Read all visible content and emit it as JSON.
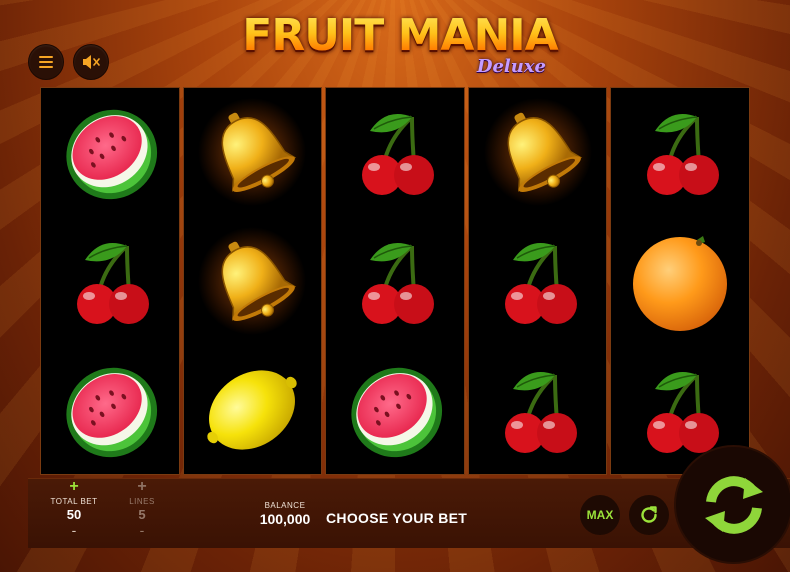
{
  "logo": {
    "main": "FRUIT MANIA",
    "sub": "Deluxe"
  },
  "controls": {
    "menu_icon": "hamburger-icon",
    "mute_icon": "speaker-muted-icon"
  },
  "reels": [
    [
      "watermelon",
      "cherries",
      "watermelon"
    ],
    [
      "bell",
      "bell",
      "lemon"
    ],
    [
      "cherries",
      "cherries",
      "watermelon"
    ],
    [
      "bell",
      "cherries",
      "cherries"
    ],
    [
      "cherries",
      "orange",
      "cherries"
    ]
  ],
  "bottom": {
    "total_bet": {
      "plus": "+",
      "label": "TOTAL BET",
      "value": "50",
      "minus": "-"
    },
    "lines": {
      "plus": "+",
      "label": "LINES",
      "value": "5",
      "minus": "-"
    },
    "balance": {
      "label": "BALANCE",
      "value": "100,000"
    },
    "message": "CHOOSE YOUR BET",
    "max_label": "MAX",
    "autoplay_icon": "refresh-icon",
    "spin_icon": "spin-arrows-icon"
  },
  "colors": {
    "accent_green": "#9be23a",
    "accent_orange": "#f6a524",
    "background": "#a8430c"
  }
}
